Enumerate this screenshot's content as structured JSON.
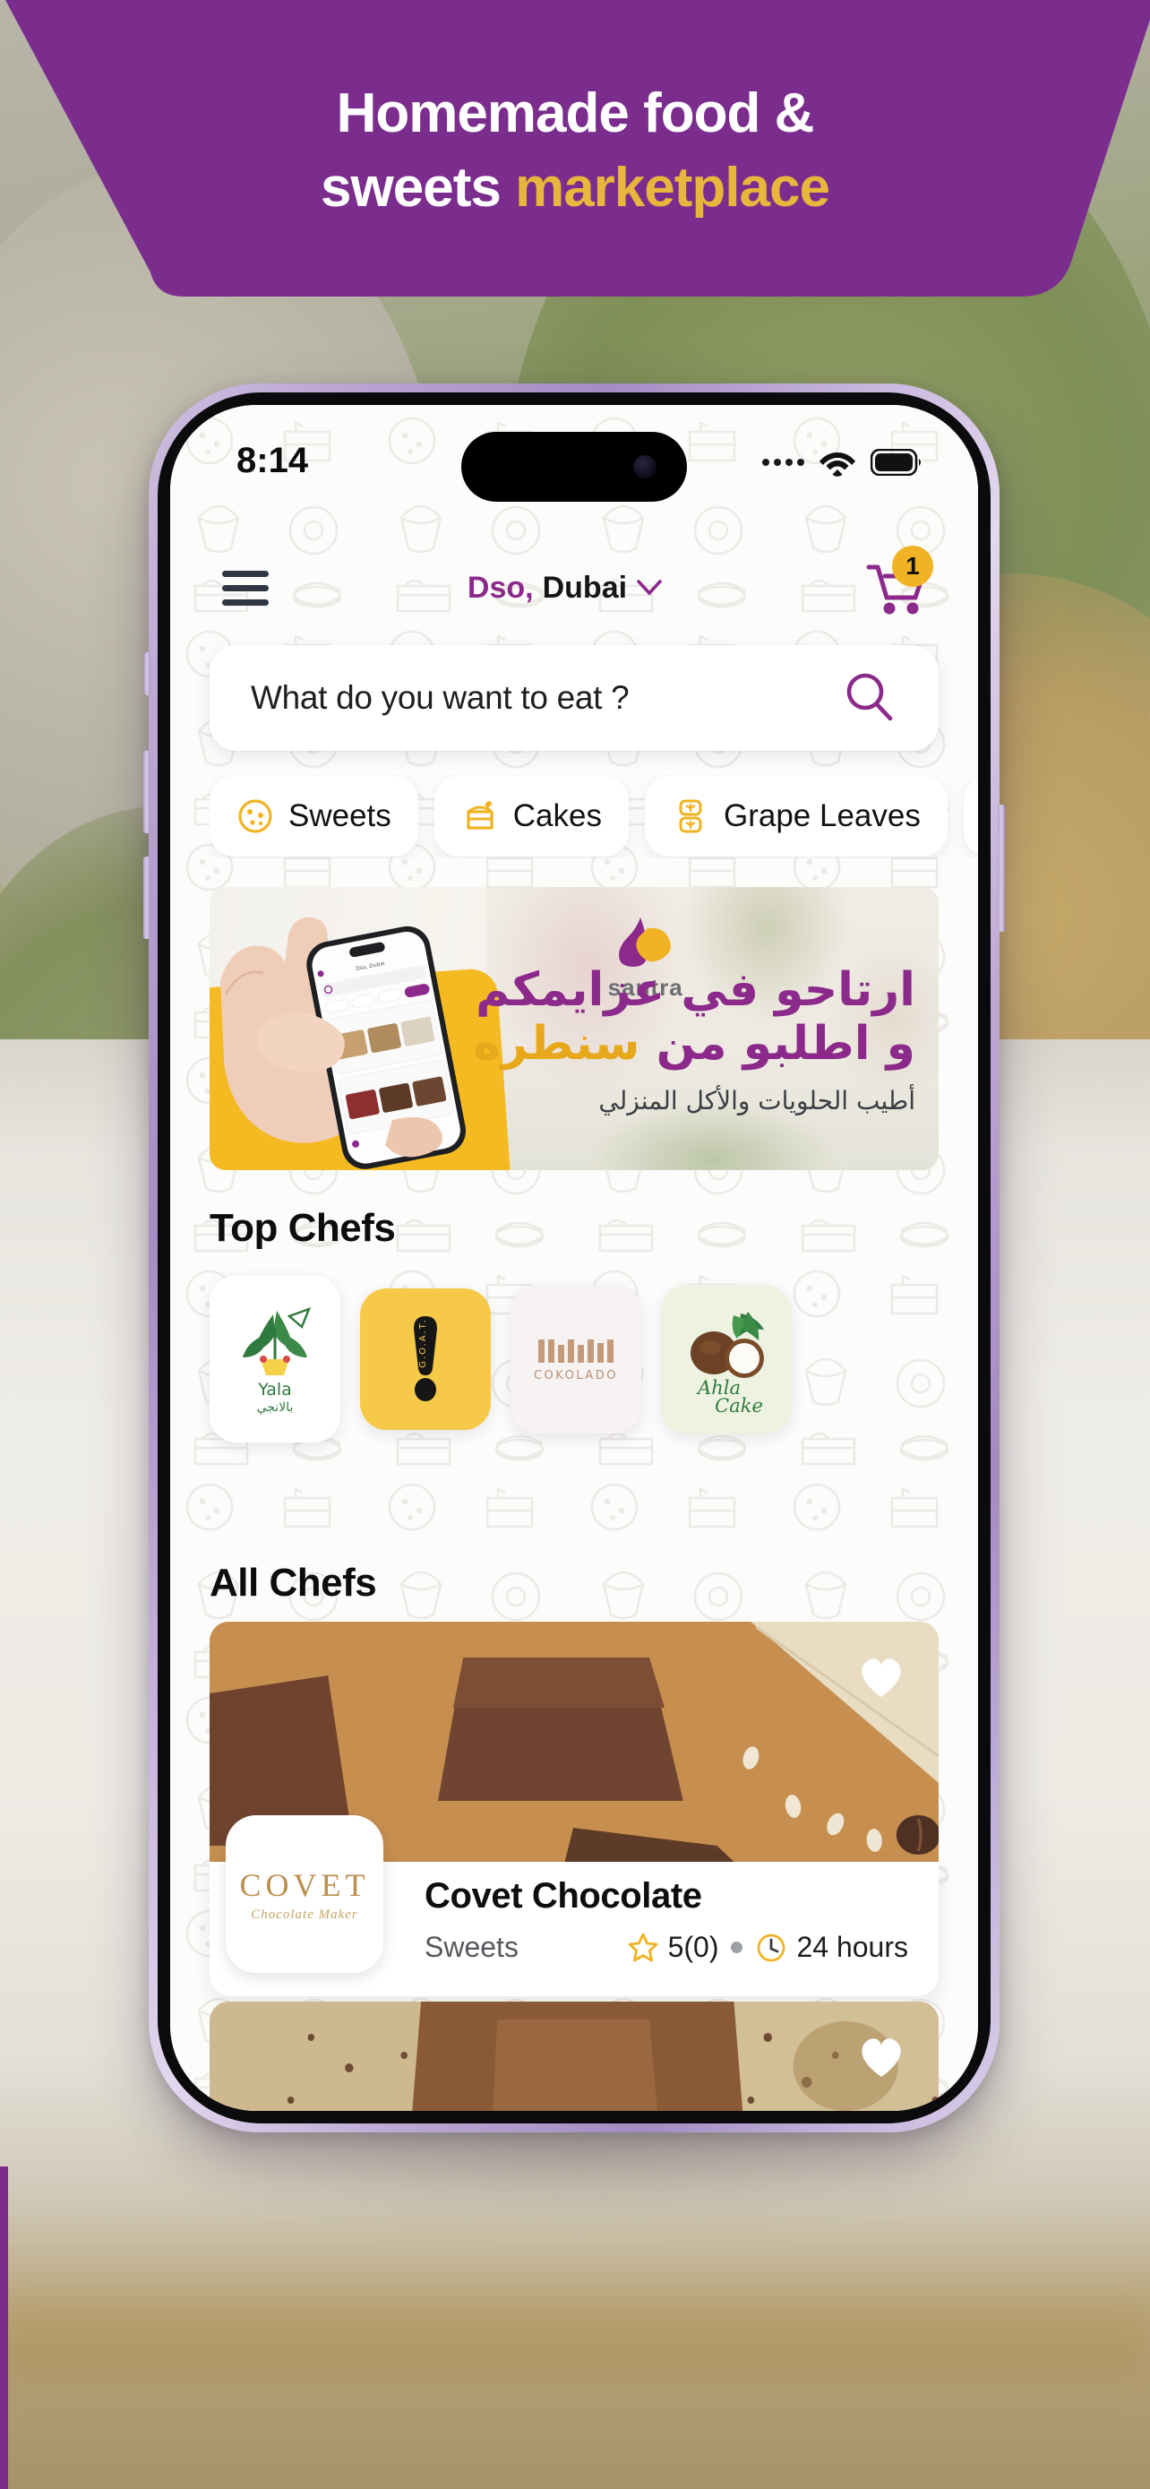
{
  "hero": {
    "line1": "Homemade food &",
    "line2_plain": "sweets ",
    "line2_accent": "marketplace",
    "bg_color": "#7b2d8e",
    "accent_color": "#e8b53d"
  },
  "phone": {
    "status_bar": {
      "time": "8:14",
      "signal_icon": "signal-dots-icon",
      "wifi_icon": "wifi-icon",
      "battery_icon": "battery-icon"
    },
    "nav": {
      "menu_icon": "hamburger-menu-icon",
      "location_city": "Dso,",
      "location_area": "Dubai",
      "chevron_icon": "chevron-down-icon",
      "cart_icon": "shopping-cart-icon",
      "cart_badge": "1",
      "cart_badge_color": "#f0b323",
      "accent_color": "#8c2a8c"
    },
    "search": {
      "placeholder": "What do you want to eat ?",
      "icon": "search-icon"
    },
    "categories": [
      {
        "label": "Sweets",
        "icon": "cookie-icon"
      },
      {
        "label": "Cakes",
        "icon": "cake-slice-icon"
      },
      {
        "label": "Grape Leaves",
        "icon": "grape-leaves-icon"
      },
      {
        "label": "",
        "icon": "partial-category-icon"
      }
    ],
    "promo": {
      "brand": "santra",
      "brand_logo_icon": "santra-drop-logo-icon",
      "headline_line1": "ارتاحو في عزايمكم",
      "headline_line2_plain": "و اطلبو من ",
      "headline_line2_accent": "سنطره",
      "subtitle": "أطيب الحلويات والأكل المنزلي",
      "phone_mockup_icon": "phone-in-hand-image",
      "accent_color": "#e8a81c",
      "headline_color": "#8c2a8c"
    },
    "sections": {
      "top_chefs_title": "Top Chefs",
      "all_chefs_title": "All Chefs"
    },
    "top_chefs": [
      {
        "name": "Yala",
        "name_ar": "بالانجي",
        "logo_icon": "yala-leaf-logo-icon",
        "bg": "#ffffff"
      },
      {
        "name": "G.O.A.T.",
        "logo_icon": "goat-exclamation-logo-icon",
        "bg": "#f7c948"
      },
      {
        "name": "COKOLADO",
        "logo_icon": "cokolado-logo-icon",
        "bg": "#f6f3f2"
      },
      {
        "name": "Ahla Cake",
        "logo_icon": "ahla-cake-coconut-logo-icon",
        "bg": "#eef3e1"
      }
    ],
    "all_chefs": [
      {
        "name": "Covet Chocolate",
        "category": "Sweets",
        "rating": "5(0)",
        "rating_icon": "star-icon",
        "prep_time": "24 hours",
        "prep_time_icon": "clock-icon",
        "favorite_icon": "heart-icon",
        "avatar_main": "COVET",
        "avatar_sub": "Chocolate Maker",
        "photo_icon": "chocolate-blocks-photo"
      },
      {
        "favorite_icon": "heart-icon",
        "photo_icon": "cocoa-dusted-dessert-photo"
      }
    ]
  }
}
